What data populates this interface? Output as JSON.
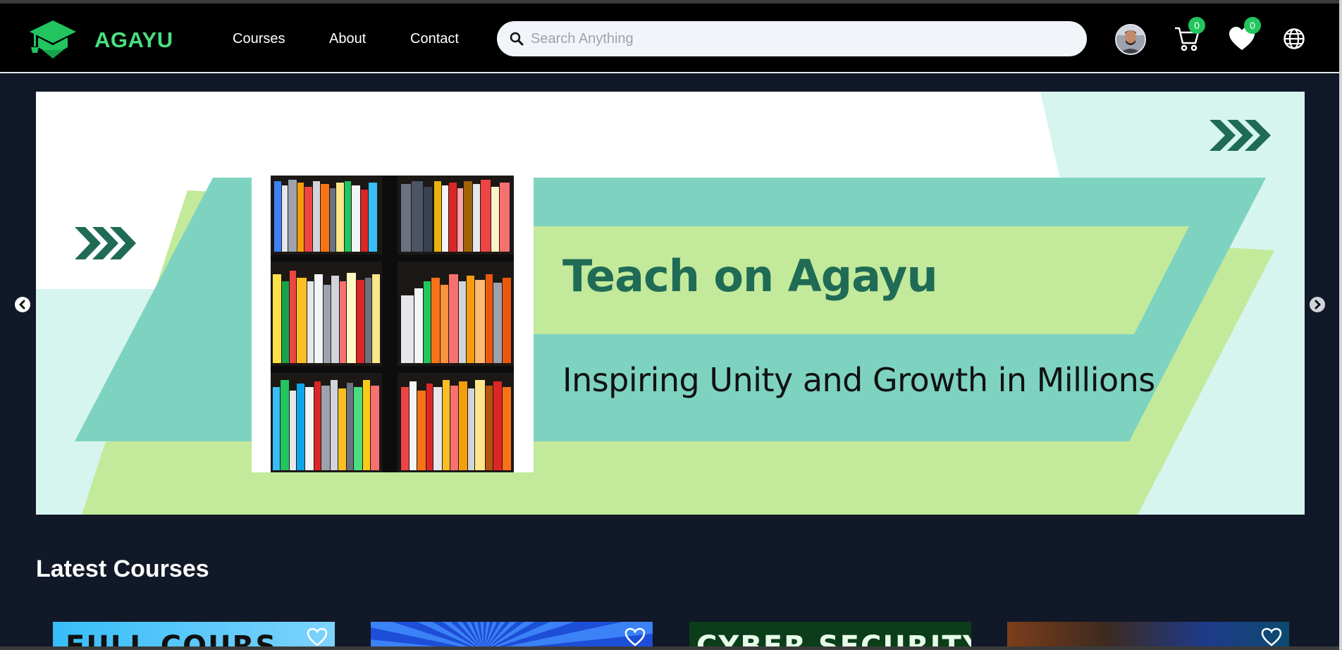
{
  "brand": {
    "name": "AGAYU",
    "logo_icon": "graduation-cap-icon",
    "accent": "#4ade80"
  },
  "nav": {
    "links": [
      {
        "label": "Courses"
      },
      {
        "label": "About"
      },
      {
        "label": "Contact"
      }
    ]
  },
  "search": {
    "placeholder": "Search Anything",
    "value": ""
  },
  "header": {
    "cart": {
      "icon": "cart-icon",
      "count": "0"
    },
    "wishlist": {
      "icon": "heart-icon",
      "count": "0"
    },
    "language": {
      "icon": "globe-icon"
    }
  },
  "banner": {
    "headline": "Teach on Agayu",
    "subline": "Inspiring Unity and Growth in Millions",
    "colors": {
      "teal": "#7dd3c0",
      "lime": "#c3e99b",
      "mint": "#d5f5ee",
      "dark_green": "#1f6b55"
    }
  },
  "latest": {
    "title": "Latest Courses",
    "courses": [
      {
        "visible_text": "FULL COURS",
        "bg": "#38bdf8"
      },
      {
        "visible_text": "",
        "bg": "#2563eb"
      },
      {
        "visible_text": "CYBER SECURITY",
        "bg": "#0b3d18"
      },
      {
        "visible_text": "",
        "bg": "#7c3e1a"
      }
    ]
  }
}
